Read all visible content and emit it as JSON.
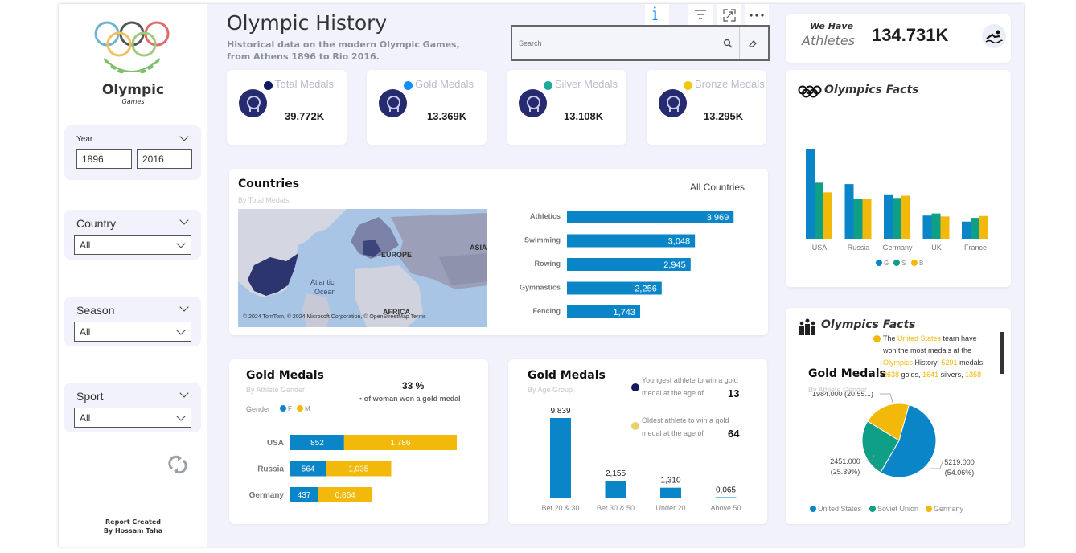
{
  "sidebar": {
    "logo_word": "Olympic",
    "logo_sub": "Games",
    "year": {
      "label": "Year",
      "from": "1896",
      "to": "2016"
    },
    "country": {
      "label": "Country",
      "value": "All"
    },
    "season": {
      "label": "Season",
      "value": "All"
    },
    "sport": {
      "label": "Sport",
      "value": "All"
    },
    "credit_line1": "Report Created",
    "credit_line2": "By Hossam Taha"
  },
  "header": {
    "title": "Olympic History",
    "subtitle_line1": "Historical data on the modern Olympic Games,",
    "subtitle_line2": "from Athens 1896 to Rio 2016.",
    "search_placeholder": "Search",
    "info_icon": "i"
  },
  "athletes": {
    "we_have": "We Have",
    "label": "Athletes",
    "value": "134.731K"
  },
  "kpis": [
    {
      "title": "Total Medals",
      "value": "39.772K",
      "color": "#12195e"
    },
    {
      "title": "Gold Medals",
      "value": "13.369K",
      "color": "#118dff"
    },
    {
      "title": "Silver Medals",
      "value": "13.108K",
      "color": "#1aab9b"
    },
    {
      "title": "Bronze Medals",
      "value": "13.295K",
      "color": "#f2c80f"
    }
  ],
  "countries": {
    "title": "Countries",
    "subtitle": "By Total Medals",
    "filter": "All Countries",
    "map_labels": {
      "europe": "EUROPE",
      "asia": "ASIA",
      "atlantic_1": "Atlantic",
      "atlantic_2": "Ocean",
      "africa": "AFRICA"
    },
    "map_credit": "© 2024 TomTom, © 2024 Microsoft Corporation, © OpenStreetMap  Terms"
  },
  "colors": {
    "blue": "#0a86c8",
    "teal": "#0e9f86",
    "gold": "#f2b80a",
    "navy": "#12195e",
    "bronze": "#f2b80a"
  },
  "chart_data": [
    {
      "type": "bar",
      "orientation": "horizontal",
      "title": "Countries",
      "categories": [
        "Athletics",
        "Swimming",
        "Rowing",
        "Gymnastics",
        "Fencing"
      ],
      "values": [
        3969,
        3048,
        2945,
        2256,
        1743
      ],
      "labels": [
        "3,969",
        "3,048",
        "2,945",
        "2,256",
        "1,743"
      ]
    },
    {
      "type": "bar",
      "title": "Olympics Facts",
      "categories": [
        "USA",
        "Russia",
        "Germany",
        "UK",
        "France"
      ],
      "series": [
        {
          "name": "G",
          "values": [
            2638,
            1599,
            1301,
            678,
            501
          ]
        },
        {
          "name": "S",
          "values": [
            1641,
            1170,
            1195,
            739,
            610
          ]
        },
        {
          "name": "B",
          "values": [
            1358,
            1178,
            1260,
            651,
            666
          ]
        }
      ],
      "legend": "bottom-center"
    },
    {
      "type": "bar",
      "orientation": "horizontal",
      "stacked": true,
      "title": "Gold Medals",
      "subtitle": "By Athlete Gender",
      "legend_title": "Gender",
      "categories": [
        "USA",
        "Russia",
        "Germany"
      ],
      "series": [
        {
          "name": "F",
          "values": [
            852,
            564,
            437
          ],
          "labels": [
            "852",
            "564",
            "437"
          ]
        },
        {
          "name": "M",
          "values": [
            1786,
            1035,
            864
          ],
          "labels": [
            "1,786",
            "1,035",
            "0,864"
          ]
        }
      ],
      "stat_value": "33 %",
      "stat_text": "• of woman won a gold medal"
    },
    {
      "type": "bar",
      "title": "Gold Medals",
      "subtitle": "By Age Group",
      "categories": [
        "Bet 20 & 30",
        "Bet 30 & 50",
        "Under 20",
        "Above 50"
      ],
      "values": [
        9839,
        2155,
        1310,
        65
      ],
      "labels": [
        "9,839",
        "2,155",
        "1,310",
        "0,065"
      ]
    },
    {
      "type": "pie",
      "title": "Gold Medals",
      "subtitle": "By Athlete Gender",
      "slices": [
        {
          "name": "United States",
          "value": 5219,
          "label_1": "5219.000",
          "label_2": "(54.06%)"
        },
        {
          "name": "Soviet Union",
          "value": 2451,
          "label_1": "2451.000",
          "label_2": "(25.39%)"
        },
        {
          "name": "Germany",
          "value": 1984,
          "label_1": "1984.000 (20.55...)",
          "label_2": ""
        }
      ],
      "legend": "bottom"
    }
  ],
  "ages": {
    "young_text_1": "Youngest athlete to win a gold",
    "young_text_2": "medal at the age of",
    "young_value": "13",
    "old_text_1": "Oldest athlete to win a gold",
    "old_text_2": "medal at the age of",
    "old_value": "64"
  },
  "facts1": {
    "title": "Olympics Facts",
    "legend": [
      "G",
      "S",
      "B"
    ]
  },
  "facts2": {
    "title": "Olympics Facts",
    "t1": "The ",
    "t2": "United States",
    "t3": " team have",
    "t4": "won the most medals at the",
    "t5": "Olympics",
    "t6": " History: ",
    "t7": "5291",
    "t8": " medals:",
    "t9": "2638",
    "t10": " golds, ",
    "t11": "1641",
    "t12": " silvers, ",
    "t13": "1358"
  }
}
